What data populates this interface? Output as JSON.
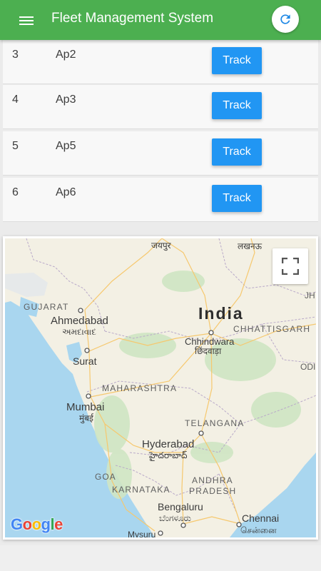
{
  "app": {
    "title": "Fleet Management System",
    "menu_icon": "menu-icon",
    "refresh_icon": "refresh-icon",
    "colors": {
      "appbar": "#4caf50",
      "accent": "#2196f3",
      "refresh_icon": "#1e88e5"
    }
  },
  "vehicles": [
    {
      "id": "3",
      "name": "Ap2",
      "action": "Track"
    },
    {
      "id": "4",
      "name": "Ap3",
      "action": "Track"
    },
    {
      "id": "5",
      "name": "Ap5",
      "action": "Track"
    },
    {
      "id": "6",
      "name": "Ap6",
      "action": "Track"
    }
  ],
  "map": {
    "fullscreen_icon": "fullscreen-icon",
    "logo": "Google",
    "labels": {
      "jaipur": "जयपुर",
      "lucknow": "लखनऊ",
      "gujarat": "GUJARAT",
      "ahmedabad": "Ahmedabad",
      "ahmedabad_local": "અમદાવાદ",
      "india": "India",
      "chhindwara": "Chhindwara",
      "chhindwara_local": "छिंदवाड़ा",
      "chhattisgarh": "CHHATTISGARH",
      "jh": "JH",
      "surat": "Surat",
      "odi": "ODI",
      "maharashtra": "MAHARASHTRA",
      "mumbai": "Mumbai",
      "mumbai_local": "मुंबई",
      "telangana": "TELANGANA",
      "hyderabad": "Hyderabad",
      "hyderabad_local": "హైదరాబాద్",
      "goa": "GOA",
      "andhra": "ANDHRA",
      "pradesh": "PRADESH",
      "karnataka": "KARNATAKA",
      "bengaluru": "Bengaluru",
      "bengaluru_local": "ಬೆಂಗಳೂರು",
      "chennai": "Chennai",
      "chennai_local": "சென்னை",
      "mysuru": "Mysuru"
    }
  }
}
